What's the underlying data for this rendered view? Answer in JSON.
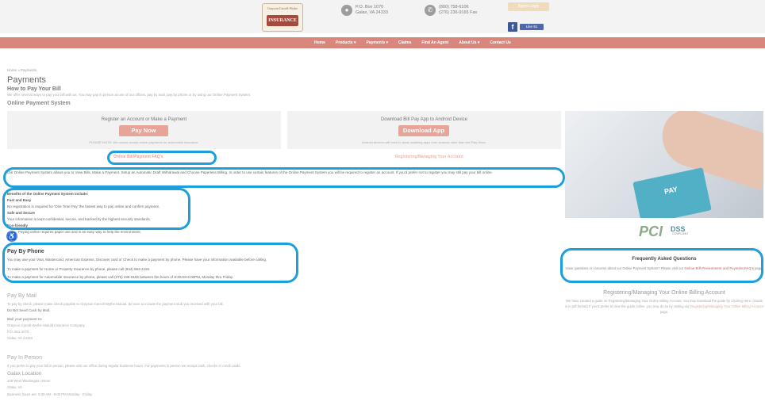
{
  "header": {
    "logo": {
      "top": "Grayson-Carroll-Wythe",
      "main": "INSURANCE"
    },
    "address": {
      "line1": "P.O. Box 1070",
      "line2": "Galax, VA 24333"
    },
    "phone": {
      "line1": "(800) 758-6106",
      "line2": "(276) 236-9165 Fax"
    },
    "login_label": "Agent Login",
    "fb_like": "Like 91"
  },
  "nav": {
    "items": [
      "Home",
      "Products ▾",
      "Payments ▾",
      "Claims",
      "Find An Agent",
      "About Us ▾",
      "Contact Us"
    ]
  },
  "page": {
    "breadcrumb": "Home » Payments",
    "title": "Payments",
    "subtitle": "How to Pay Your Bill",
    "intro": "We offer several ways to pay your bill with us. You may pay in person at one of our offices, pay by mail, pay by phone or by using our Online Payment System.",
    "online_heading": "Online Payment System"
  },
  "cards": {
    "register": {
      "title": "Register an Account or Make a Payment",
      "button": "Pay Now",
      "note": "PLEASE NOTE: We cannot accept online payments for automobile insurance."
    },
    "app": {
      "title": "Download Bill Pay App to Android Device",
      "button": "Download App",
      "note": "Android devices will need to allow installing apps from sources other than the Play Store."
    }
  },
  "links": {
    "faq": "Online Bill/Payment FAQ's",
    "manage": "Registering/Managing Your Account"
  },
  "online_paragraph": "Our Online Payment System allows you to View Bills, Make a Payment, Setup an Automatic Draft Withdrawal and Choose Paperless Billing. In order to use certain features of the Online Payment System you will be required to register an account. If you'd prefer not to register you may still pay your bill online.",
  "benefits": {
    "heading": "Benefits of the Online Payment System include:",
    "fast_title": "Fast and Easy",
    "fast_text": "No registration is required for 'One Time Pay' the fastest way to pay online and confirm payment.",
    "safe_title": "Safe and Secure",
    "safe_text": "Your information is kept confidential, secure, and backed by the highest security standards.",
    "green_title": "Eco-friendly",
    "green_text": "Paying online requires paper use and is an easy way to help the environment."
  },
  "phone_section": {
    "heading": "Pay By Phone",
    "line1": "You may use your Visa, Mastercard, American Express, Discover card or Check to make a payment by phone. Please have your information available before calling.",
    "line2": "To make a payment for Home or Property Insurance by phone, please call (844) 863-4119.",
    "line3": "To make a payment for Automobile Insurance by phone, please call (276) 236-9106 between the hours of 8:30AM-5:00PM, Monday thru Friday."
  },
  "faq": {
    "title": "Frequently Asked Questions",
    "text_before": "Have questions or concerns about our Online Payment System? Please visit our",
    "link": "Online Bill Presentment and Payment FAQ's",
    "text_after": "page."
  },
  "manage_account": {
    "title": "Registering/Managing Your Online Billing Account",
    "text": "We have created a guide on Registering/Managing Your Online Billing Account. You may download the guide by Clicking Here. (Guide is in pdf format) If you'd prefer to view the guide online, you may do so by visiting our",
    "link": "Registering/Managing Your Online Billing Account",
    "text_after": "page."
  },
  "mail": {
    "heading": "Pay By Mail",
    "line1": "To pay by check, please make check payable to Grayson-Carroll-Wythe Mutual. Be sure to include the payment stub you received with your bill.",
    "line2": "Do Not Send Cash by Mail.",
    "line3": "Mail your payment to:",
    "line4": "Grayson-Carroll-Wythe Mutual Insurance Company",
    "line5": "P.O. Box 1070",
    "line6": "Galax, VA 24333"
  },
  "in_person": {
    "heading": "Pay In Person",
    "line1": "If you prefer to pay your bill in person, please visit our office during regular business hours. For payments in person we accept cash, checks or credit cards.",
    "location": "Galax Location",
    "street": "109 West Washington Street",
    "city": "Galax, VA",
    "hours": "Business hours are: 8:30 AM - 5:00 PM Monday - Friday"
  },
  "pci": {
    "pci": "PCI",
    "dss": "DSS",
    "compliant": "COMPLIANT"
  },
  "colors": {
    "nav": "#d9867c",
    "button": "#e7a499",
    "highlight": "#1d9fdb"
  }
}
